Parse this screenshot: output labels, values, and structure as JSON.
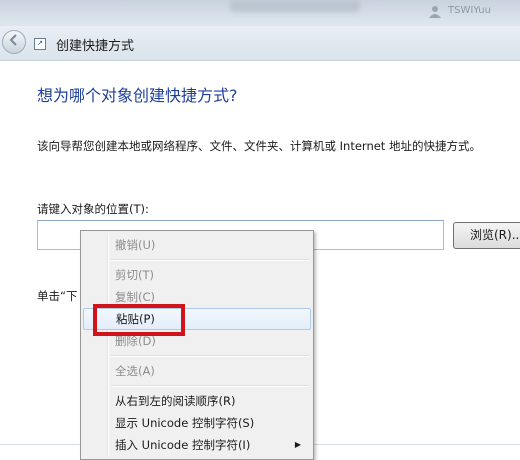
{
  "titlebar": {
    "user_label": "TSWIYuu"
  },
  "nav": {
    "title": "创建快捷方式",
    "back_icon": "back-arrow-icon"
  },
  "main": {
    "heading": "想为哪个对象创建快捷方式?",
    "description": "该向导帮您创建本地或网络程序、文件、文件夹、计算机或 Internet 地址的快捷方式。",
    "location_label": "请键入对象的位置(T):",
    "location_value": "",
    "browse_label": "浏览(R)...",
    "hint": "单击“下"
  },
  "context_menu": {
    "items": [
      {
        "label": "撤销(U)",
        "enabled": false
      },
      {
        "label": "剪切(T)",
        "enabled": false
      },
      {
        "label": "复制(C)",
        "enabled": false
      },
      {
        "label": "粘贴(P)",
        "enabled": true,
        "highlighted": true
      },
      {
        "label": "删除(D)",
        "enabled": false
      },
      {
        "label": "全选(A)",
        "enabled": false
      },
      {
        "label": "从右到左的阅读顺序(R)",
        "enabled": true
      },
      {
        "label": "显示 Unicode 控制字符(S)",
        "enabled": true
      },
      {
        "label": "插入 Unicode 控制字符(I)",
        "enabled": true,
        "submenu": true
      }
    ],
    "highlight_color": "#d0141c"
  }
}
